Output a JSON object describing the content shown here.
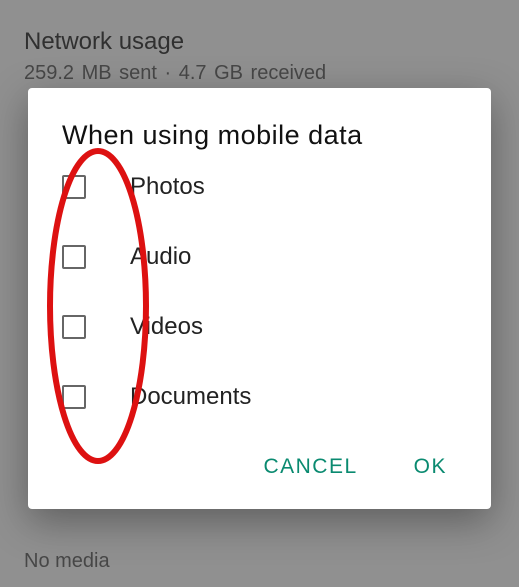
{
  "background": {
    "title": "Network usage",
    "subtitle": "259.2 MB sent · 4.7 GB received",
    "bottom": "No media"
  },
  "dialog": {
    "title": "When using mobile data",
    "options": [
      {
        "label": "Photos"
      },
      {
        "label": "Audio"
      },
      {
        "label": "Videos"
      },
      {
        "label": "Documents"
      }
    ],
    "actions": {
      "cancel": "CANCEL",
      "ok": "OK"
    }
  }
}
